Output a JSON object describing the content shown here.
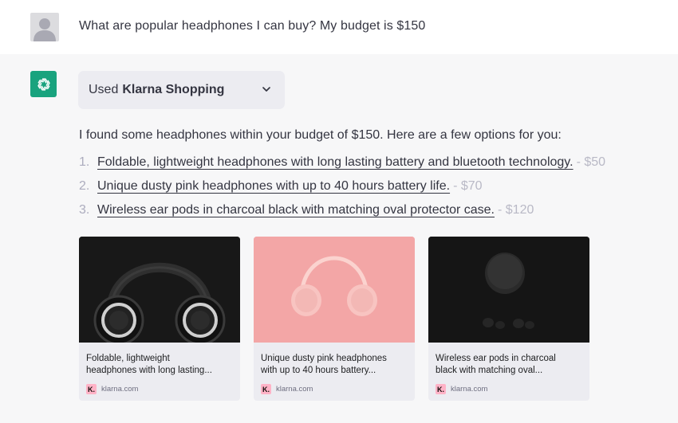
{
  "user": {
    "message": "What are popular headphones I can buy? My budget is $150"
  },
  "assistant": {
    "plugin": {
      "prefix": "Used",
      "name": "Klarna Shopping"
    },
    "intro": "I found some headphones within your budget of $150. Here are a few options for you:",
    "items": [
      {
        "num": "1.",
        "text": "Foldable, lightweight headphones with long lasting battery and bluetooth technology.",
        "price": "- $50"
      },
      {
        "num": "2.",
        "text": "Unique dusty pink headphones with up to 40 hours battery life.",
        "price": "- $70"
      },
      {
        "num": "3.",
        "text": "Wireless ear pods in charcoal black with matching oval protector case.",
        "price": "- $120"
      }
    ],
    "cards": [
      {
        "title_line1": "Foldable, lightweight",
        "title_line2": "headphones with long lasting...",
        "source": "klarna.com",
        "logo": "K."
      },
      {
        "title_line1": "Unique dusty pink headphones",
        "title_line2": "with up to 40 hours battery...",
        "source": "klarna.com",
        "logo": "K."
      },
      {
        "title_line1": "Wireless ear pods in charcoal",
        "title_line2": "black with matching oval...",
        "source": "klarna.com",
        "logo": "K."
      }
    ]
  },
  "icons": {
    "user_avatar": "user-avatar-icon",
    "assistant_avatar": "openai-logo-icon",
    "chevron": "chevron-down-icon"
  },
  "colors": {
    "assistant_bg": "#f7f7f8",
    "openai_green": "#19a37e",
    "klarna_pink": "#ffb3c7"
  }
}
